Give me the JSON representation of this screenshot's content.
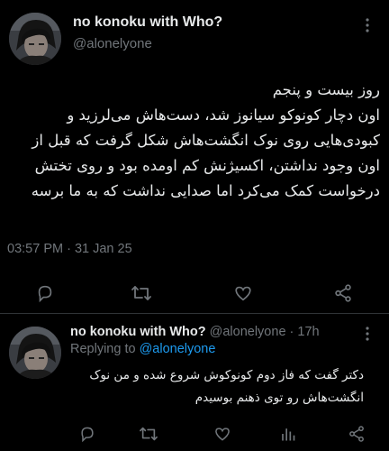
{
  "colors": {
    "background": "#000000",
    "text": "#e7e9ea",
    "muted": "#71767b",
    "link": "#1d9bf0",
    "divider": "#2f3336"
  },
  "main_tweet": {
    "author_name": "no konoku with Who?",
    "author_handle": "@alonelyone",
    "body_lines": [
      "روز بیست و پنجم",
      "اون دچار کونوکو سیانوز شد، دست‌هاش می‌لرزید و",
      "کبودی‌هایی روی نوک انگشت‌هاش شکل گرفت که قبل از",
      "اون وجود نداشتن، اکسیژنش کم اومده بود و روی تختش",
      "درخواست کمک می‌کرد اما صدایی نداشت که به ما برسه"
    ],
    "timestamp": "03:57 PM · 31 Jan 25",
    "icons": [
      "more-icon",
      "reply-icon",
      "retweet-icon",
      "like-icon",
      "share-icon"
    ]
  },
  "reply_tweet": {
    "author_name": "no konoku with Who?",
    "author_handle": "@alonelyone",
    "time_ago": "17h",
    "replying_to_label": "Replying to",
    "replying_to_handle": "@alonelyone",
    "body_lines": [
      "دکتر گفت که فاز دوم کونوکوش شروع شده و من نوک",
      "انگشت‌هاش رو توی ذهنم بوسیدم"
    ],
    "icons": [
      "more-icon",
      "reply-icon",
      "retweet-icon",
      "like-icon",
      "views-icon",
      "share-icon"
    ]
  }
}
